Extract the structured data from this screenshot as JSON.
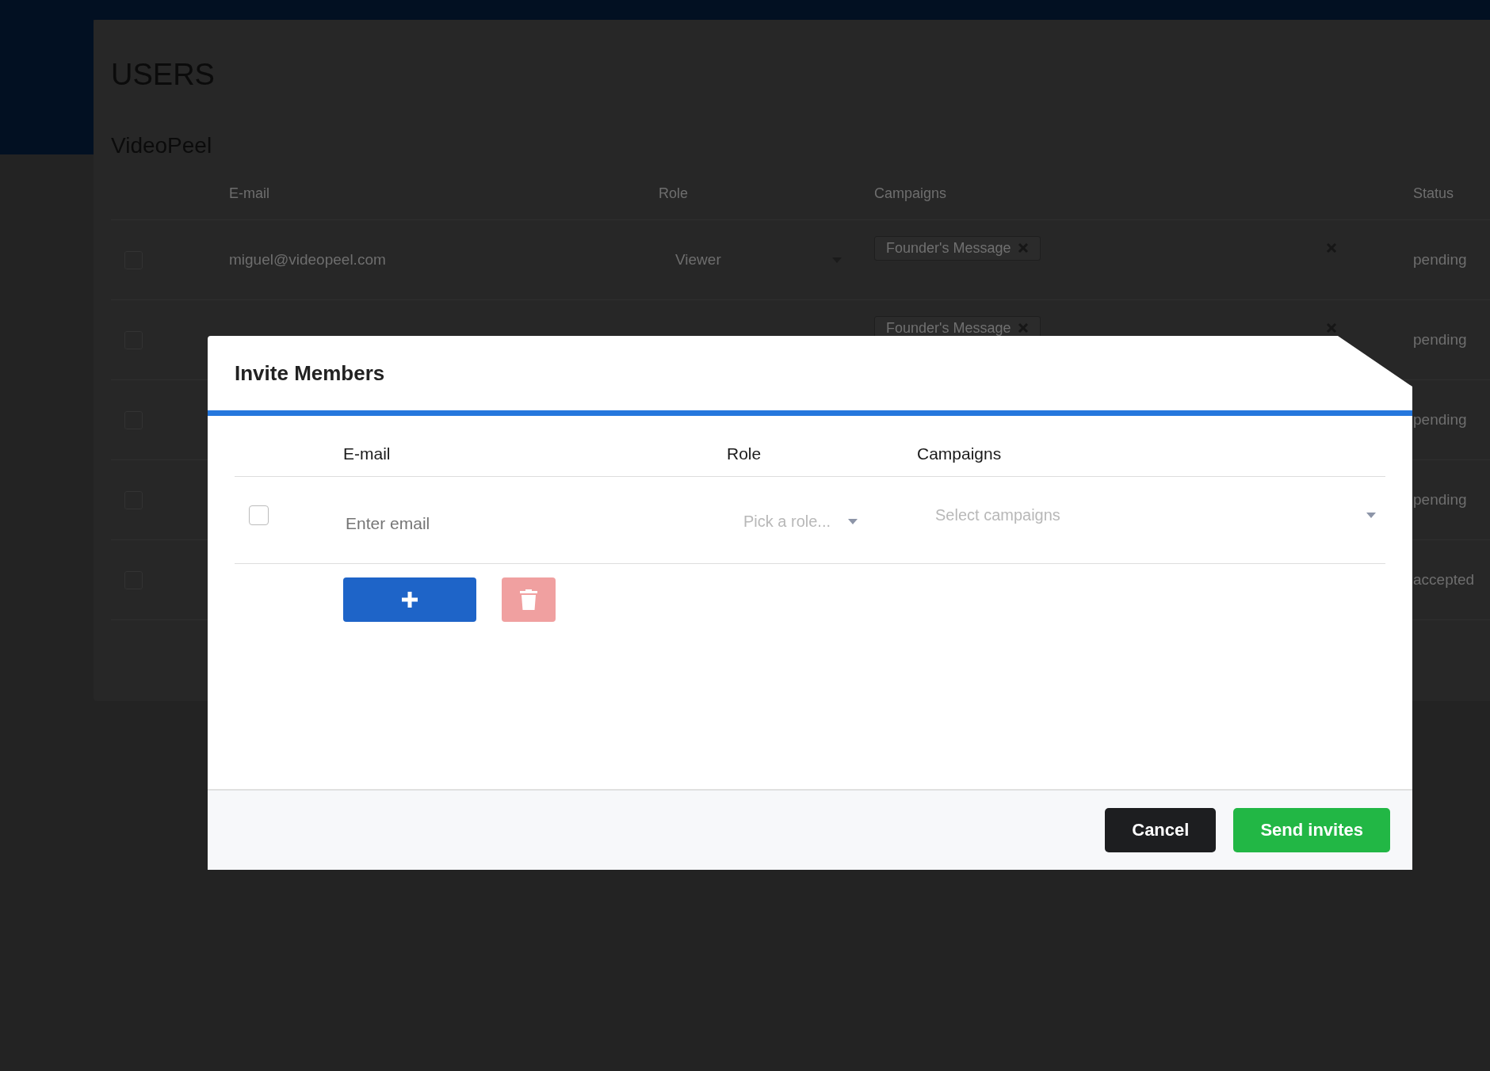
{
  "page": {
    "title": "USERS",
    "subtitle": "VideoPeel"
  },
  "table": {
    "columns": [
      "E-mail",
      "Role",
      "Campaigns",
      "Status"
    ],
    "rows": [
      {
        "checked": false,
        "email": "miguel@videopeel.com",
        "role": "Viewer",
        "campaigns": [
          "Founder's Message"
        ],
        "status": "pending"
      },
      {
        "checked": false,
        "campaigns": [
          "Founder's Message"
        ],
        "status": "pending"
      },
      {
        "checked": false,
        "status": "pending"
      },
      {
        "checked": false,
        "status": "pending"
      },
      {
        "checked": false,
        "status": "accepted"
      }
    ]
  },
  "modal": {
    "title": "Invite Members",
    "columns": [
      "E-mail",
      "Role",
      "Campaigns"
    ],
    "rows": [
      {
        "checked": false,
        "email_placeholder": "Enter email",
        "role_placeholder": "Pick a role...",
        "campaigns_placeholder": "Select campaigns"
      }
    ],
    "buttons": [
      "Cancel",
      "Send invites"
    ]
  }
}
